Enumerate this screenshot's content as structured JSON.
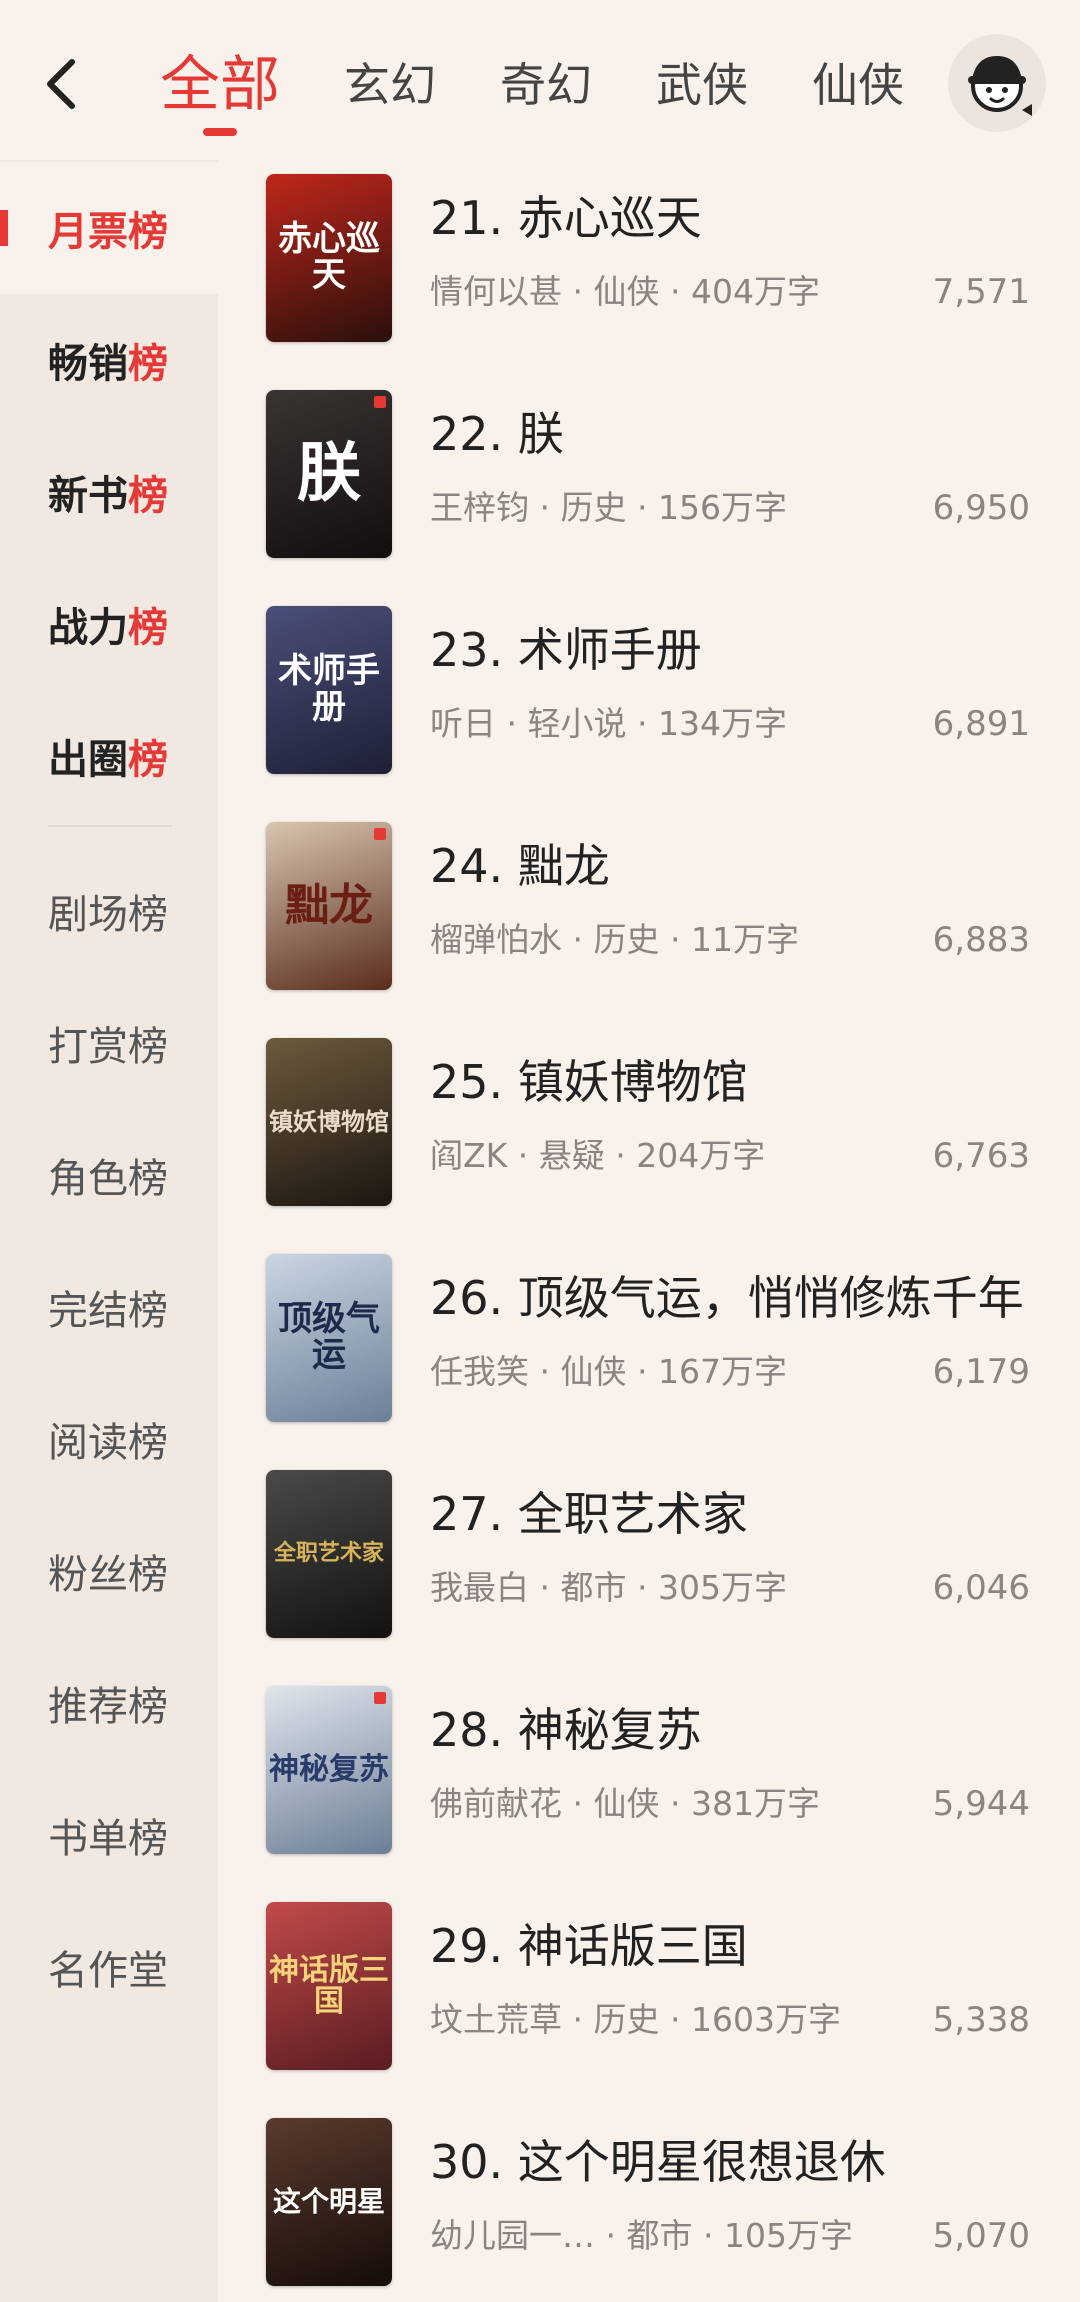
{
  "colors": {
    "accent": "#e53935",
    "background": "#f9f2ec",
    "sidebar": "#f1e8e2"
  },
  "header": {
    "back_icon": "chevron-left-icon",
    "tabs": [
      {
        "label": "全部",
        "active": true
      },
      {
        "label": "玄幻"
      },
      {
        "label": "奇幻"
      },
      {
        "label": "武侠"
      },
      {
        "label": "仙侠"
      }
    ],
    "avatar_icon": "user-avatar-icon"
  },
  "sidebar": {
    "primary": [
      {
        "label": "月票",
        "suffix": "榜",
        "active": true
      },
      {
        "label": "畅销",
        "suffix": "榜"
      },
      {
        "label": "新书",
        "suffix": "榜"
      },
      {
        "label": "战力",
        "suffix": "榜"
      },
      {
        "label": "出圈",
        "suffix": "榜"
      }
    ],
    "secondary": [
      {
        "label": "剧场榜"
      },
      {
        "label": "打赏榜"
      },
      {
        "label": "角色榜"
      },
      {
        "label": "完结榜"
      },
      {
        "label": "阅读榜"
      },
      {
        "label": "粉丝榜"
      },
      {
        "label": "推荐榜"
      },
      {
        "label": "书单榜"
      },
      {
        "label": "名作堂"
      }
    ]
  },
  "books": [
    {
      "title": "21. 赤心巡天",
      "author": "情何以甚",
      "genre": "仙侠",
      "words": "404万字",
      "votes": "7,571",
      "cover_text": "赤心巡天",
      "cover_colors": [
        "#c0271b",
        "#2a0f0c"
      ]
    },
    {
      "title": "22. 朕",
      "author": "王梓钧",
      "genre": "历史",
      "words": "156万字",
      "votes": "6,950",
      "cover_text": "朕",
      "cover_colors": [
        "#3a3432",
        "#120e0d"
      ]
    },
    {
      "title": "23. 术师手册",
      "author": "听日",
      "genre": "轻小说",
      "words": "134万字",
      "votes": "6,891",
      "cover_text": "术师手册",
      "cover_colors": [
        "#4a4f7a",
        "#1e2036"
      ]
    },
    {
      "title": "24. 黜龙",
      "author": "榴弹怕水",
      "genre": "历史",
      "words": "11万字",
      "votes": "6,883",
      "cover_text": "黜龙",
      "cover_colors": [
        "#d8c6b0",
        "#5a2c1e"
      ]
    },
    {
      "title": "25. 镇妖博物馆",
      "author": "阎ZK",
      "genre": "悬疑",
      "words": "204万字",
      "votes": "6,763",
      "cover_text": "镇妖博物馆",
      "cover_colors": [
        "#6d5a3e",
        "#1c1610"
      ]
    },
    {
      "title": "26. 顶级气运，悄悄修炼千年",
      "author": "任我笑",
      "genre": "仙侠",
      "words": "167万字",
      "votes": "6,179",
      "cover_text": "顶级气运",
      "cover_colors": [
        "#c9d6e3",
        "#6b7f96"
      ]
    },
    {
      "title": "27. 全职艺术家",
      "author": "我最白",
      "genre": "都市",
      "words": "305万字",
      "votes": "6,046",
      "cover_text": "全职艺术家",
      "cover_colors": [
        "#4a4a48",
        "#111111"
      ]
    },
    {
      "title": "28. 神秘复苏",
      "author": "佛前献花",
      "genre": "仙侠",
      "words": "381万字",
      "votes": "5,944",
      "cover_text": "神秘复苏",
      "cover_colors": [
        "#dfe5ec",
        "#6c7f95"
      ]
    },
    {
      "title": "29. 神话版三国",
      "author": "坟土荒草",
      "genre": "历史",
      "words": "1603万字",
      "votes": "5,338",
      "cover_text": "神话版三国",
      "cover_colors": [
        "#c24a4a",
        "#5a1c22"
      ]
    },
    {
      "title": "30. 这个明星很想退休",
      "author": "幼儿园一…",
      "genre": "都市",
      "words": "105万字",
      "votes": "5,070",
      "cover_text": "这个明星",
      "cover_colors": [
        "#5a3b2e",
        "#150c08"
      ]
    }
  ]
}
